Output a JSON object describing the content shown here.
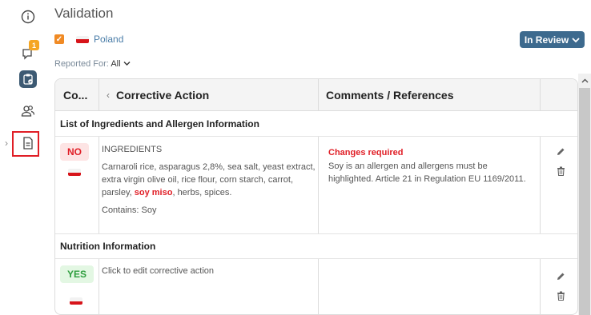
{
  "header": {
    "title": "Validation",
    "market": "Poland",
    "status": "In Review",
    "reported_label": "Reported For:",
    "reported_value": "All"
  },
  "rail": {
    "badge_count": "1",
    "items": [
      "info-icon",
      "comments-icon",
      "clipboard-check-icon",
      "users-icon",
      "document-icon"
    ]
  },
  "table": {
    "columns": [
      "Co...",
      "Corrective Action",
      "Comments / References"
    ],
    "sections": [
      {
        "title": "List of Ingredients and Allergen Information",
        "rows": [
          {
            "status": "NO",
            "field": "INGREDIENTS",
            "text_before": "Carnaroli rice, asparagus 2,8%, sea salt, yeast extract, extra virgin olive oil, rice flour, corn starch, carrot, parsley, ",
            "text_highlight": "soy miso",
            "text_after": ", herbs, spices.",
            "contains": "Contains: Soy",
            "comment_label": "Changes required",
            "comment_text": "Soy is an allergen and allergens must be highlighted. Article 21 in Regulation EU 1169/2011."
          }
        ]
      },
      {
        "title": "Nutrition Information",
        "rows": [
          {
            "status": "YES",
            "placeholder": "Click to edit corrective action"
          }
        ]
      }
    ]
  },
  "colors": {
    "accent": "#3d6a8e",
    "error": "#e01e26",
    "success": "#2e9e3e",
    "checkbox": "#f08a24",
    "badge": "#f5a623"
  }
}
